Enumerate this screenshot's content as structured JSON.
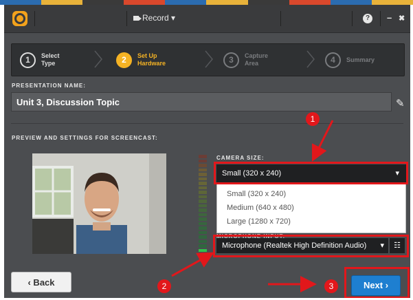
{
  "colors": {
    "accent": "#f5b324",
    "annotation": "#e2171b",
    "primary_button": "#1e7fd0"
  },
  "titlebar": {
    "record_label": "Record ▾",
    "help_icon": "question-icon",
    "minimize": "–",
    "close": "✖"
  },
  "steps": [
    {
      "num": "1",
      "line1": "Select",
      "line2": "Type"
    },
    {
      "num": "2",
      "line1": "Set Up",
      "line2": "Hardware"
    },
    {
      "num": "3",
      "line1": "Capture",
      "line2": "Area"
    },
    {
      "num": "4",
      "line1": "Summary",
      "line2": ""
    }
  ],
  "presentation": {
    "label": "PRESENTATION NAME:",
    "value": "Unit 3, Discussion Topic"
  },
  "preview_label": "PREVIEW AND SETTINGS FOR SCREENCAST:",
  "camera": {
    "label": "CAMERA SIZE:",
    "selected": "Small (320 x 240)",
    "options": [
      "Small (320 x 240)",
      "Medium (640 x 480)",
      "Large (1280 x 720)"
    ]
  },
  "microphone": {
    "label": "MICROPHONE INPUT:",
    "selected": "Microphone (Realtek High Definition Audio)"
  },
  "buttons": {
    "back": "‹ Back",
    "next": "Next ›"
  },
  "callouts": [
    "1",
    "2",
    "3"
  ]
}
